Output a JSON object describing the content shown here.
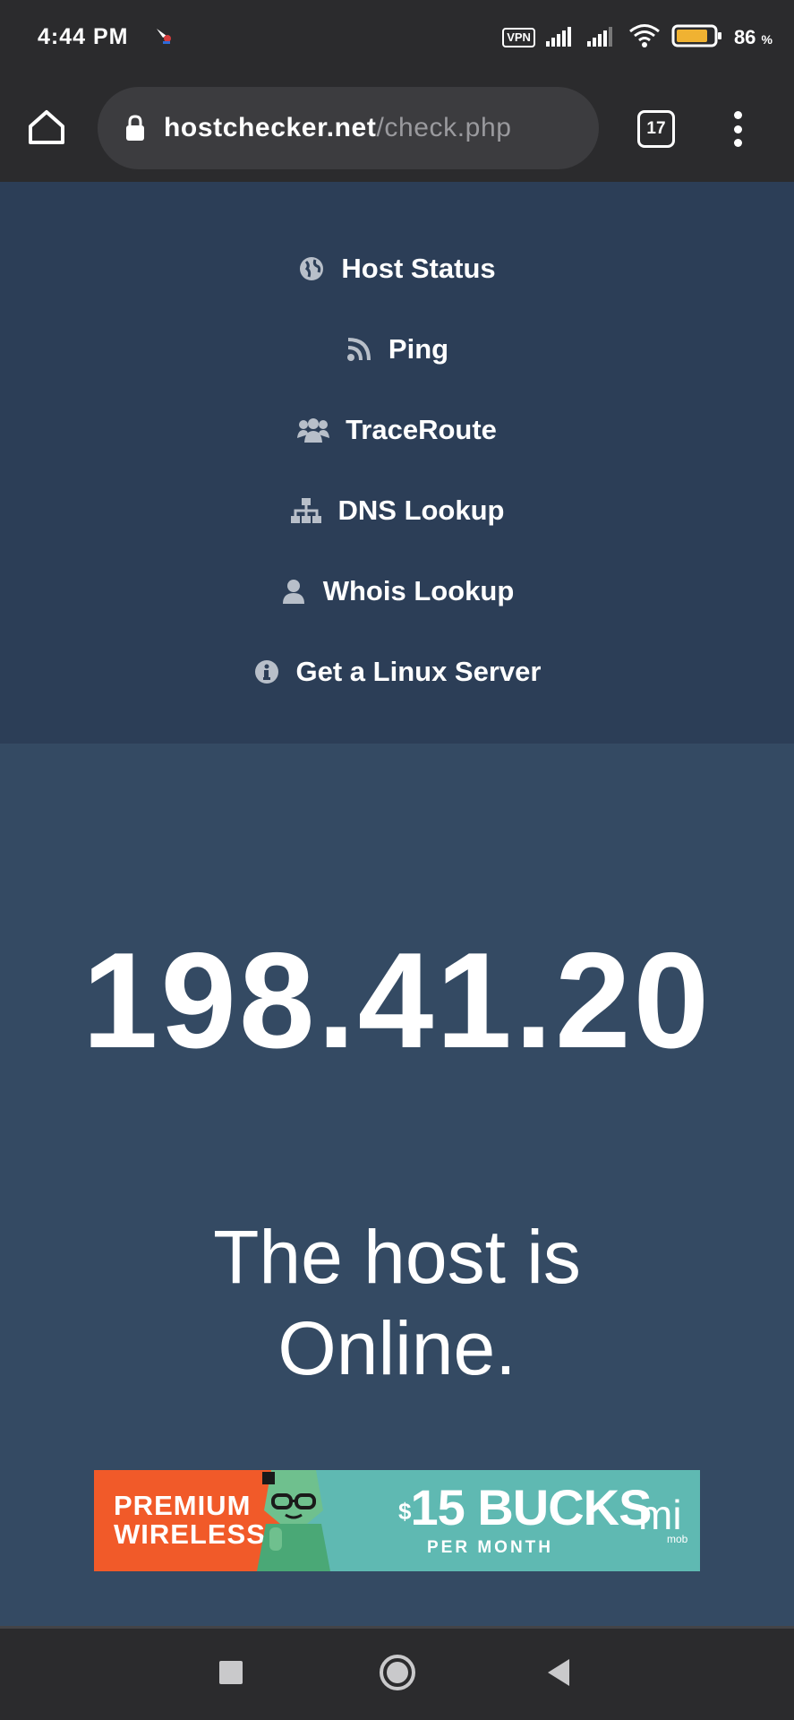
{
  "status_bar": {
    "time": "4:44 PM",
    "vpn_label": "VPN",
    "battery_percent": "86",
    "battery_unit": "%",
    "battery_level": 0.86,
    "icons": [
      "notification-icon",
      "vpn-icon",
      "signal-icon",
      "signal-icon",
      "wifi-icon",
      "battery-icon"
    ]
  },
  "browser": {
    "url_host": "hostchecker.net",
    "url_path": "/check.php",
    "tab_count": "17",
    "icons": [
      "home-icon",
      "lock-icon",
      "tabs-icon",
      "menu-icon"
    ]
  },
  "nav": {
    "items": [
      {
        "label": "Host Status",
        "icon": "globe-icon"
      },
      {
        "label": "Ping",
        "icon": "rss-icon"
      },
      {
        "label": "TraceRoute",
        "icon": "users-icon"
      },
      {
        "label": "DNS Lookup",
        "icon": "sitemap-icon"
      },
      {
        "label": "Whois Lookup",
        "icon": "user-icon"
      },
      {
        "label": "Get a Linux Server",
        "icon": "info-icon"
      }
    ]
  },
  "main": {
    "ip_address": "198.41.20",
    "status_line1": "The host is",
    "status_line2": "Online."
  },
  "ad": {
    "left_line1": "PREMIUM",
    "left_line2": "WIRELESS",
    "price_currency": "$",
    "price_amount": "15 BUCKS",
    "period": "PER MONTH",
    "brand": "mi",
    "brand_sub": "mob"
  },
  "colors": {
    "nav_bg": "#2c3e57",
    "main_bg": "#344a63",
    "ad_orange": "#f15a29",
    "ad_teal": "#5fb9b2",
    "chrome_bg": "#2b2b2d"
  }
}
